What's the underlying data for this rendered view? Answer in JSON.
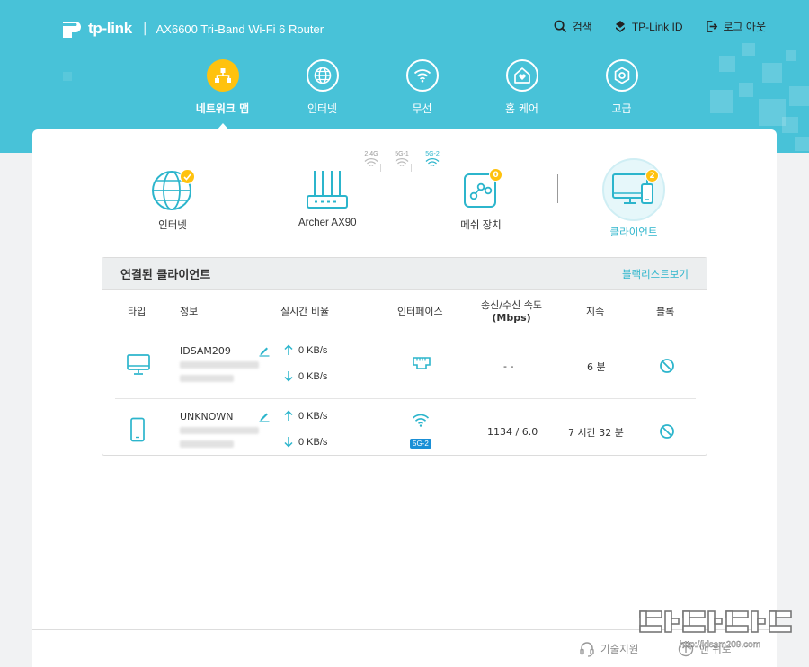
{
  "brand": {
    "logo_text": "tp-link",
    "separator": "|",
    "model": "AX6600 Tri-Band Wi-Fi 6 Router",
    "accent": "#48c2d8",
    "highlight": "#ffc20e",
    "link_color": "#2cb5cc"
  },
  "top_links": [
    {
      "label": "검색",
      "icon": "search-icon"
    },
    {
      "label": "TP-Link ID",
      "icon": "tplink-id-icon"
    },
    {
      "label": "로그 아웃",
      "icon": "logout-icon"
    }
  ],
  "nav": [
    {
      "label": "네트워크 맵",
      "icon": "network-map-icon",
      "active": true
    },
    {
      "label": "인터넷",
      "icon": "globe-icon",
      "active": false
    },
    {
      "label": "무선",
      "icon": "wifi-icon",
      "active": false
    },
    {
      "label": "홈 케어",
      "icon": "home-care-icon",
      "active": false
    },
    {
      "label": "고급",
      "icon": "gear-icon",
      "active": false
    }
  ],
  "topology": {
    "internet": {
      "label": "인터넷",
      "status": "connected"
    },
    "router": {
      "label": "Archer AX90"
    },
    "bands": [
      {
        "label": "2.4G",
        "active": false
      },
      {
        "label": "5G-1",
        "active": false
      },
      {
        "label": "5G-2",
        "active": true
      }
    ],
    "band_sep": "|",
    "mesh": {
      "label": "메쉬 장치",
      "count": "0"
    },
    "clients": {
      "label": "클라이언트",
      "count": "2"
    }
  },
  "clients_panel": {
    "title": "연결된 클라이언트",
    "blacklist_link": "블랙리스트보기",
    "columns": {
      "type": "타입",
      "info": "정보",
      "realtime": "실시간 비율",
      "interface": "인터페이스",
      "rate_line1": "송신/수신 속도",
      "rate_line2": "(Mbps)",
      "duration": "지속",
      "block": "블록"
    },
    "rows": [
      {
        "type": "desktop",
        "name": "IDSAM209",
        "up": "0 KB/s",
        "down": "0 KB/s",
        "interface": "ethernet",
        "interface_tag": "",
        "rate": "- -",
        "duration": "6 분"
      },
      {
        "type": "mobile",
        "name": "UNKNOWN",
        "up": "0 KB/s",
        "down": "0 KB/s",
        "interface": "wifi",
        "interface_tag": "5G-2",
        "rate": "1134 / 6.0",
        "duration": "7 시간 32 분"
      }
    ]
  },
  "footer": {
    "support": "기술지원",
    "second_link": "맨 위로"
  },
  "watermark": {
    "url": "http://idsam209.com"
  }
}
